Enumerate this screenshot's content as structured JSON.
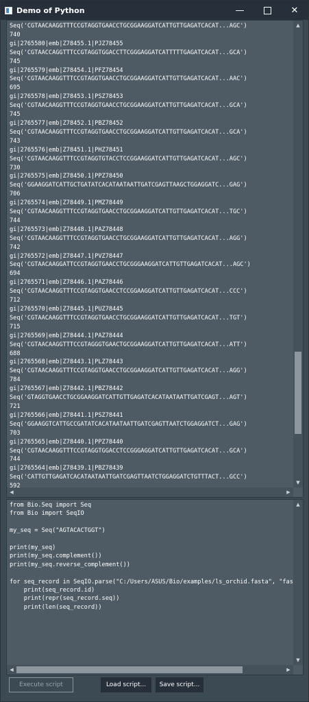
{
  "window": {
    "title": "Demo of Python",
    "minimize": "—",
    "close": "✕"
  },
  "output": {
    "lines": [
      "Seq('CGTAACAAGGTTTCCGTAGGTGAACCTGCGGAAGGATCATTGTTGAGATCACAT...AGC')",
      "740",
      "gi|2765580|emb|Z78455.1|PJZ78455",
      "Seq('CGTAACCAGGTTTCCGTAGGTGGACCTTCGGGAGGATCATTTTTGAGATCACAT...GCA')",
      "745",
      "gi|2765579|emb|Z78454.1|PFZ78454",
      "Seq('CGTAACAAGGTTTCCGTAGGTGAACCTGCGGAAGGATCATTGTTGAGATCACAT...AAC')",
      "695",
      "gi|2765578|emb|Z78453.1|PSZ78453",
      "Seq('CGTAACAAGGTTTCCGTAGGTGAACCTGCGGAAGGATCATTGTTGAGATCACAT...GCA')",
      "745",
      "gi|2765577|emb|Z78452.1|PBZ78452",
      "Seq('CGTAACAAGGTTTCCGTAGGTGAACCTGCGGAAGGATCATTGTTGAGATCACAT...GCA')",
      "743",
      "gi|2765576|emb|Z78451.1|PHZ78451",
      "Seq('CGTAACAAGGTTTCCGTAGGTGTACCTCCGGAAGGATCATTGTTGAGATCACAT...AGC')",
      "730",
      "gi|2765575|emb|Z78450.1|PPZ78450",
      "Seq('GGAAGGATCATTGCTGATATCACATAATAATTGATCGAGTTAAGCTGGAGGATC...GAG')",
      "706",
      "gi|2765574|emb|Z78449.1|PMZ78449",
      "Seq('CGTAACAAGGTTTCCGTAGGTGAACCTGCGGAAGGATCATTGTTGAGATCACAT...TGC')",
      "744",
      "gi|2765573|emb|Z78448.1|PAZ78448",
      "Seq('CGTAACAAGGTTTCCGTAGGTGAACCTGCGGAAGGATCATTGTTGAGATCACAT...AGG')",
      "742",
      "gi|2765572|emb|Z78447.1|PVZ78447",
      "Seq('CGTAACAAGGATTCCGTAGGTGAACCTGCGGGAAGGATCATTGTTGAGATCACAT...AGC')",
      "694",
      "gi|2765571|emb|Z78446.1|PAZ78446",
      "Seq('CGTAACAAGGTTTCCGTAGGTGAACCTCCGGAAGGATCATTGTTGAGATCACAT...CCC')",
      "712",
      "gi|2765570|emb|Z78445.1|PUZ78445",
      "Seq('CGTAACAAGGTTTCCGTAGGTGAACCTGCGGAAGGATCATTGTTGAGATCACAT...TGT')",
      "715",
      "gi|2765569|emb|Z78444.1|PAZ78444",
      "Seq('CGTAACAAGGTTTCCGTAGGGTGAACTGCGGAAGGATCATTGTTGAGATCACAT...ATT')",
      "688",
      "gi|2765568|emb|Z78443.1|PLZ78443",
      "Seq('CGTAACAAGGTTTCCGTAGGTGAACCTGCGGAAGGATCATTGTTGAGATCACAT...AGG')",
      "784",
      "gi|2765567|emb|Z78442.1|PBZ78442",
      "Seq('GTAGGTGAACCTGCGGAAGGATCATTGTTGAGATCACATAATAATTGATCGAGT...AGT')",
      "721",
      "gi|2765566|emb|Z78441.1|PSZ78441",
      "Seq('GGAAGGTCATTGCCGATATCACATAATAATTGATCGAGTTAATCTGGAGGATCT...GAG')",
      "703",
      "gi|2765565|emb|Z78440.1|PPZ78440",
      "Seq('CGTAACAAGGTTTCCGTAGGTGGACCTCCGGGAGGATCATTGTTGAGATCACAT...GCA')",
      "744",
      "gi|2765564|emb|Z78439.1|PBZ78439",
      "Seq('CATTGTTGAGATCACATAATAATTGATCGAGTTAATCTGGAGGATCTGTTTACT...GCC')",
      "592"
    ]
  },
  "script": {
    "lines": [
      "from Bio.Seq import Seq",
      "from Bio import SeqIO",
      "",
      "my_seq = Seq(\"AGTACACTGGT\")",
      "",
      "print(my_seq)",
      "print(my_seq.complement())",
      "print(my_seq.reverse_complement())",
      "",
      "for seq_record in SeqIO.parse(\"C:/Users/ASUS/Bio/examples/ls_orchid.fasta\", \"fasta\"):",
      "    print(seq_record.id)",
      "    print(repr(seq_record.seq))",
      "    print(len(seq_record))"
    ]
  },
  "buttons": {
    "execute": "Execute script",
    "load": "Load script...",
    "save": "Save script..."
  },
  "scroll": {
    "output_vertical_position": 0.88,
    "script_horizontal_position": 0.0
  },
  "colors": {
    "titlebar": "#27303a",
    "background": "#3c4a54",
    "pane": "#4e5b64",
    "text": "#ffffff"
  }
}
